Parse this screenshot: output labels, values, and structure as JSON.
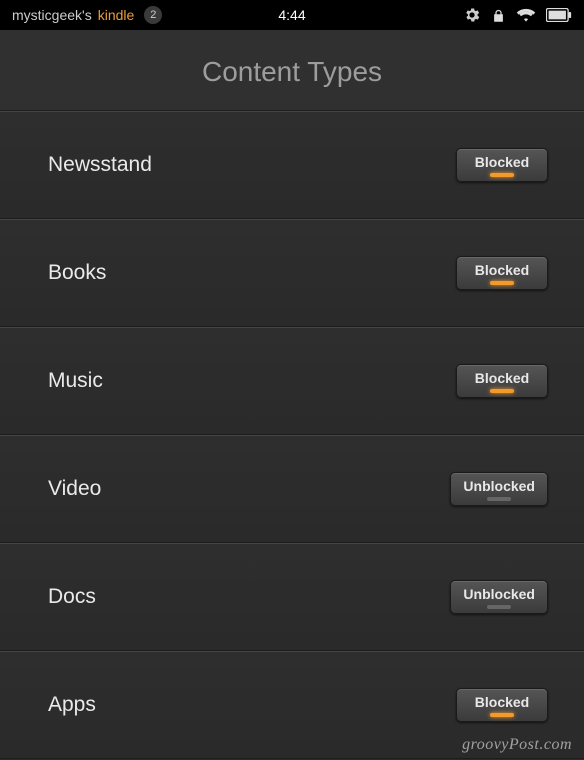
{
  "status": {
    "device_user": "mysticgeek's",
    "device_brand": "kindle",
    "notification_count": "2",
    "time": "4:44"
  },
  "icons": {
    "settings": "settings-icon",
    "lock": "lock-icon",
    "wifi": "wifi-icon",
    "battery": "battery-icon"
  },
  "title": "Content Types",
  "rows": [
    {
      "label": "Newsstand",
      "state": "Blocked"
    },
    {
      "label": "Books",
      "state": "Blocked"
    },
    {
      "label": "Music",
      "state": "Blocked"
    },
    {
      "label": "Video",
      "state": "Unblocked"
    },
    {
      "label": "Docs",
      "state": "Unblocked"
    },
    {
      "label": "Apps",
      "state": "Blocked"
    }
  ],
  "watermark": "groovyPost.com"
}
